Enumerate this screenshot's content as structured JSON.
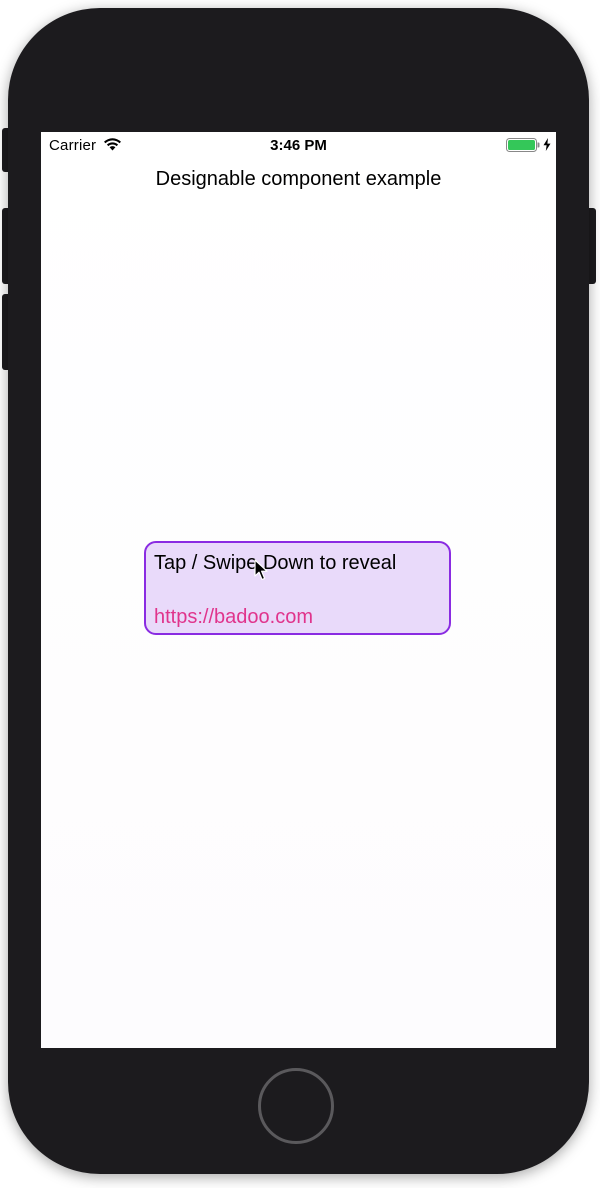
{
  "status_bar": {
    "carrier": "Carrier",
    "time": "3:46 PM",
    "icons": [
      "wifi-icon",
      "battery-icon",
      "charging-bolt-icon"
    ],
    "battery_color": "#34c759"
  },
  "nav": {
    "title": "Designable component example"
  },
  "card": {
    "title": "Tap / Swipe Down to reveal",
    "link": "https://badoo.com",
    "background_color": "#e9dafa",
    "border_color": "#8a2be2",
    "link_color": "#e0348c"
  },
  "device": {
    "frame_color": "#1c1b1e",
    "icons": [
      "home-button",
      "pointer-cursor-icon"
    ]
  }
}
